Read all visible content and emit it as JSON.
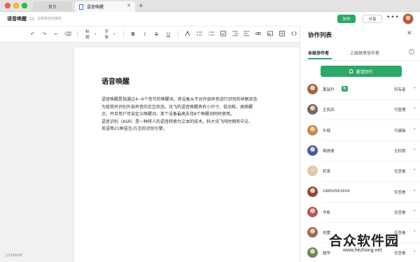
{
  "window": {
    "tabs": [
      {
        "label": "首页"
      },
      {
        "label": "语音唤醒"
      }
    ],
    "tab_close": "✕",
    "tab_add": "+"
  },
  "header": {
    "doc_title": "语音唤醒",
    "save_status": "文档将自动保存",
    "collab_button": "协作",
    "share_button": "分享",
    "more": "•••"
  },
  "toolbar": {
    "undo": "↶",
    "redo": "↷",
    "format_paint": "⌐",
    "clear_format": "⌫",
    "heading_label": "标题",
    "font_label": "字体",
    "bold": "B",
    "italic": "I",
    "strike": "S",
    "underline": "U",
    "caret": "▾"
  },
  "document": {
    "title": "语音唤醒",
    "paragraphs": [
      "语音唤醒是指通过4~6个音节的唤醒词，将设备从不对外部声音进行识别的休眠状态",
      "为接受并识别外部声音的交互状态。讯飞的语音唤醒具有小尺寸、低功耗、高唤醒",
      "点，并且用户可自定义唤醒词，单个设备最高支持8个唤醒词同时使用。",
      "语音识别（ASR）是一种将人的语音转换为文本的技术。科大讯飞同时拥有中文、",
      "英语等21种语言/方言的识别引擎。"
    ],
    "word_count": "123456字"
  },
  "panel": {
    "title": "协作列表",
    "close": "✕",
    "tab_current": "本级协作者",
    "tab_parent": "上级继承协作者",
    "info": "i",
    "invite_button": "邀请协作",
    "members": [
      {
        "name": "黄淑丹",
        "badge": "我",
        "role": "所有者",
        "avatar": "#a0673f"
      },
      {
        "name": "王凤凤",
        "badge": "",
        "role": "可管理",
        "avatar": "#6b6b6b"
      },
      {
        "name": "牛顿",
        "badge": "",
        "role": "可编辑",
        "avatar": "#c48a4a"
      },
      {
        "name": "蒋倩倩",
        "badge": "",
        "role": "无权限",
        "avatar": "#3a5fb0"
      },
      {
        "name": "奶茶",
        "badge": "",
        "role": "仅查看",
        "avatar": "#d8c9b0"
      },
      {
        "name": "18850561604",
        "badge": "",
        "role": "仅查看",
        "avatar": "#8c4a3a"
      },
      {
        "name": "华凯",
        "badge": "",
        "role": "仅查看",
        "avatar": "#b05a5a"
      },
      {
        "name": "刘雯",
        "badge": "",
        "role": "仅查看",
        "avatar": "#9a6b5a"
      },
      {
        "name": "超华",
        "badge": "",
        "role": "仅查看",
        "avatar": "#6a8a5a"
      }
    ],
    "role_caret": "▾"
  },
  "watermark": {
    "text": "合众软件园",
    "url": "www.hezhong.net"
  }
}
